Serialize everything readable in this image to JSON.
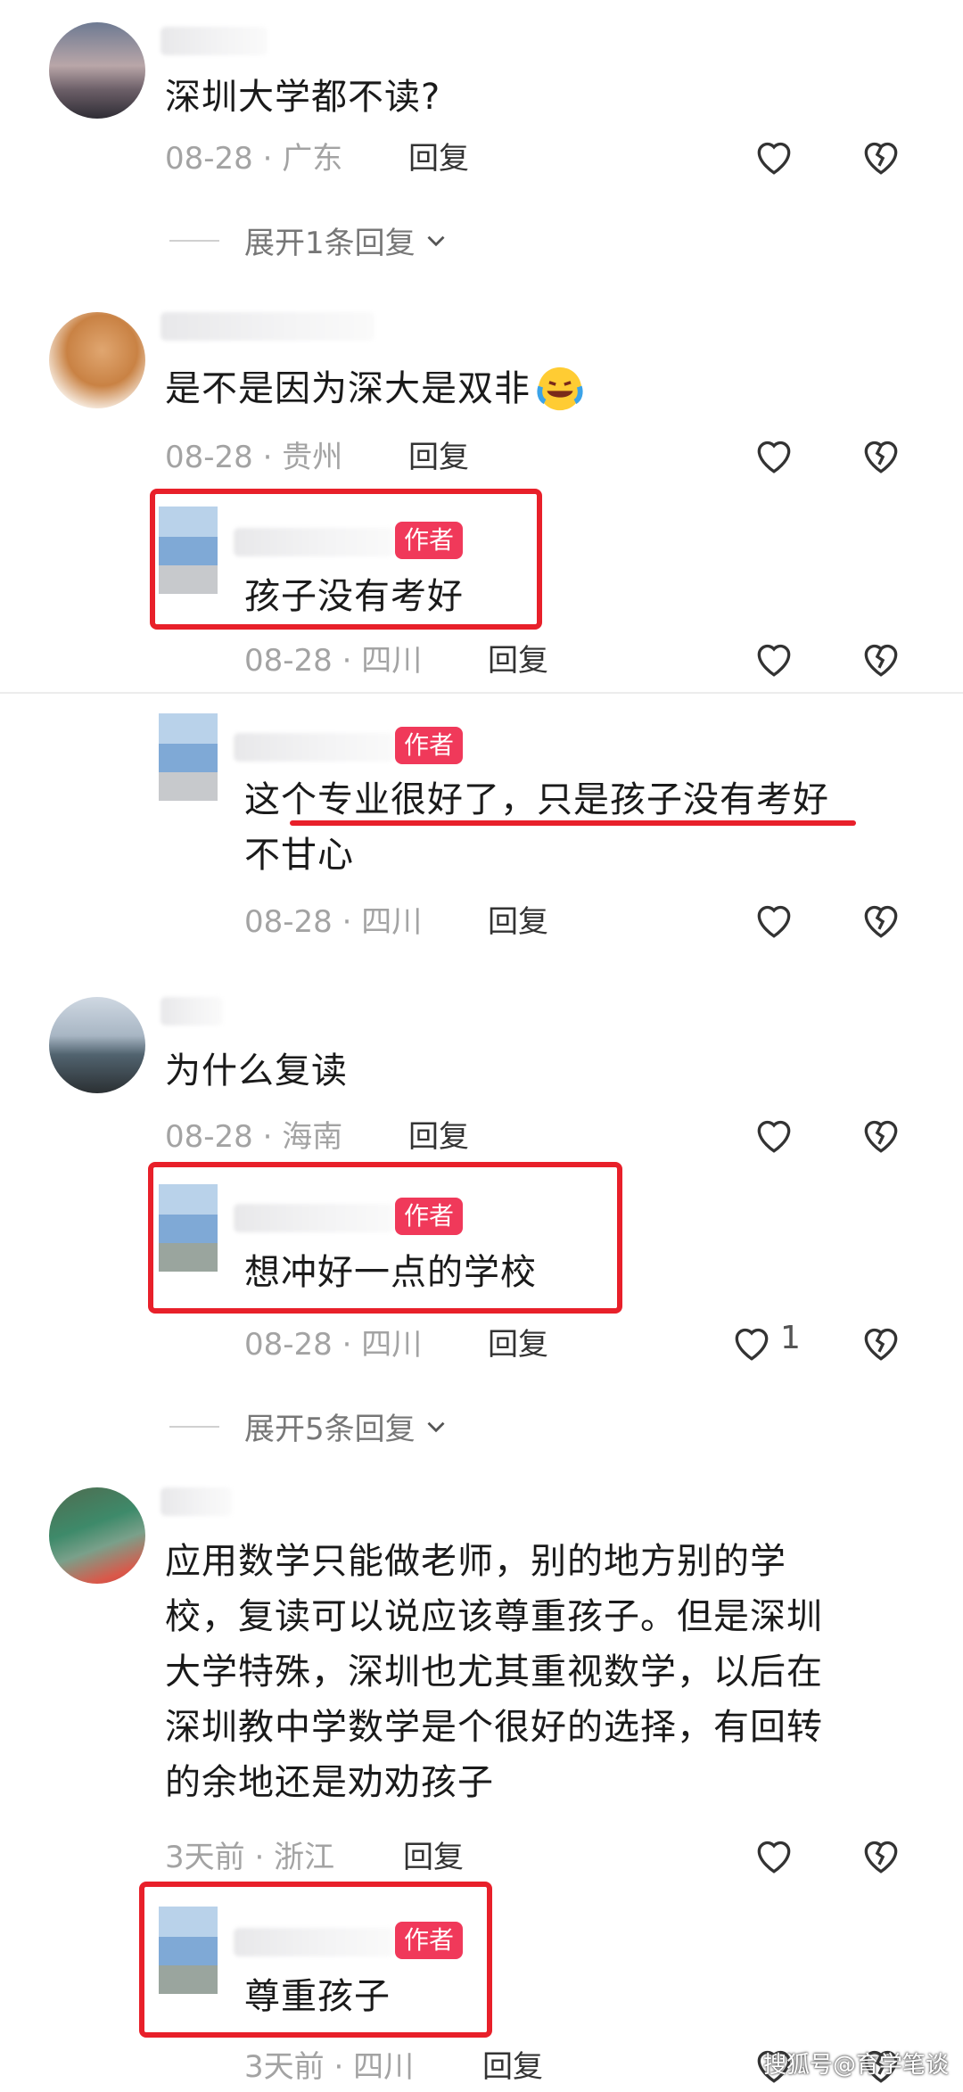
{
  "comments": [
    {
      "text": "深圳大学都不读?",
      "date": "08-28",
      "location": "广东",
      "reply": "回复"
    },
    {
      "text": "是不是因为深大是双非",
      "date": "08-28",
      "location": "贵州",
      "reply": "回复"
    },
    {
      "text": "为什么复读",
      "date": "08-28",
      "location": "海南",
      "reply": "回复"
    },
    {
      "text_lines": [
        "应用数学只能做老师，别的地方别的学",
        "校，复读可以说应该尊重孩子。但是深圳",
        "大学特殊，深圳也尤其重视数学，以后在",
        "深圳教中学数学是个很好的选择，有回转",
        "的余地还是劝劝孩子"
      ],
      "date": "3天前",
      "location": "浙江",
      "reply": "回复"
    }
  ],
  "replies": [
    {
      "tag": "作者",
      "text": "孩子没有考好",
      "date": "08-28",
      "location": "四川",
      "reply": "回复"
    },
    {
      "tag": "作者",
      "text_lines": [
        "这个专业很好了，只是孩子没有考好",
        "不甘心"
      ],
      "date": "08-28",
      "location": "四川",
      "reply": "回复"
    },
    {
      "tag": "作者",
      "text": "想冲好一点的学校",
      "date": "08-28",
      "location": "四川",
      "reply": "回复",
      "likes": "1"
    },
    {
      "tag": "作者",
      "text": "尊重孩子",
      "date": "3天前",
      "location": "四川",
      "reply": "回复"
    }
  ],
  "expand": [
    {
      "label": "展开1条回复"
    },
    {
      "label": "展开5条回复"
    }
  ],
  "separator": "·",
  "watermark": "搜狐号@育学笔谈",
  "icons": {
    "like": "heart-outline-icon",
    "dislike": "broken-heart-icon",
    "chevron": "chevron-down-icon",
    "emoji": "crying-laughing-emoji-icon"
  },
  "colors": {
    "author_tag": "#f0395a",
    "highlight_box": "#e8202a",
    "meta": "#a3a3a3"
  }
}
